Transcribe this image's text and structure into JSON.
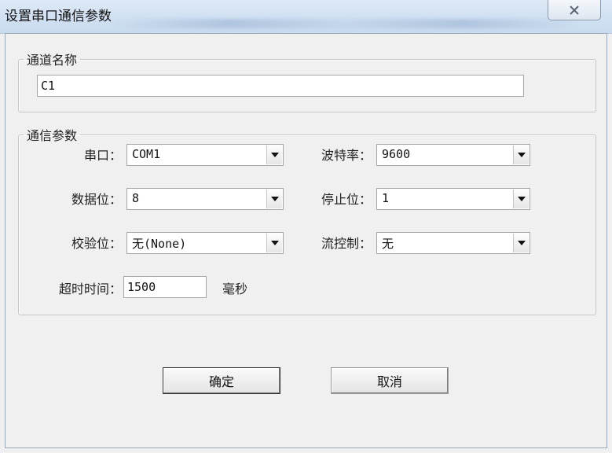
{
  "window": {
    "title": "设置串口通信参数",
    "close_icon": "close-icon"
  },
  "channel_group": {
    "legend": "通道名称",
    "name_value": "C1"
  },
  "comm_group": {
    "legend": "通信参数",
    "port": {
      "label": "串口：",
      "value": "COM1"
    },
    "baud": {
      "label": "波特率：",
      "value": "9600"
    },
    "data_bits": {
      "label": "数据位：",
      "value": "8"
    },
    "stop_bits": {
      "label": "停止位：",
      "value": "1"
    },
    "parity": {
      "label": "校验位：",
      "value": "无(None)"
    },
    "flow": {
      "label": "流控制：",
      "value": "无"
    },
    "timeout": {
      "label": "超时时间：",
      "value": "1500",
      "unit": "毫秒"
    }
  },
  "buttons": {
    "ok": "确定",
    "cancel": "取消"
  }
}
